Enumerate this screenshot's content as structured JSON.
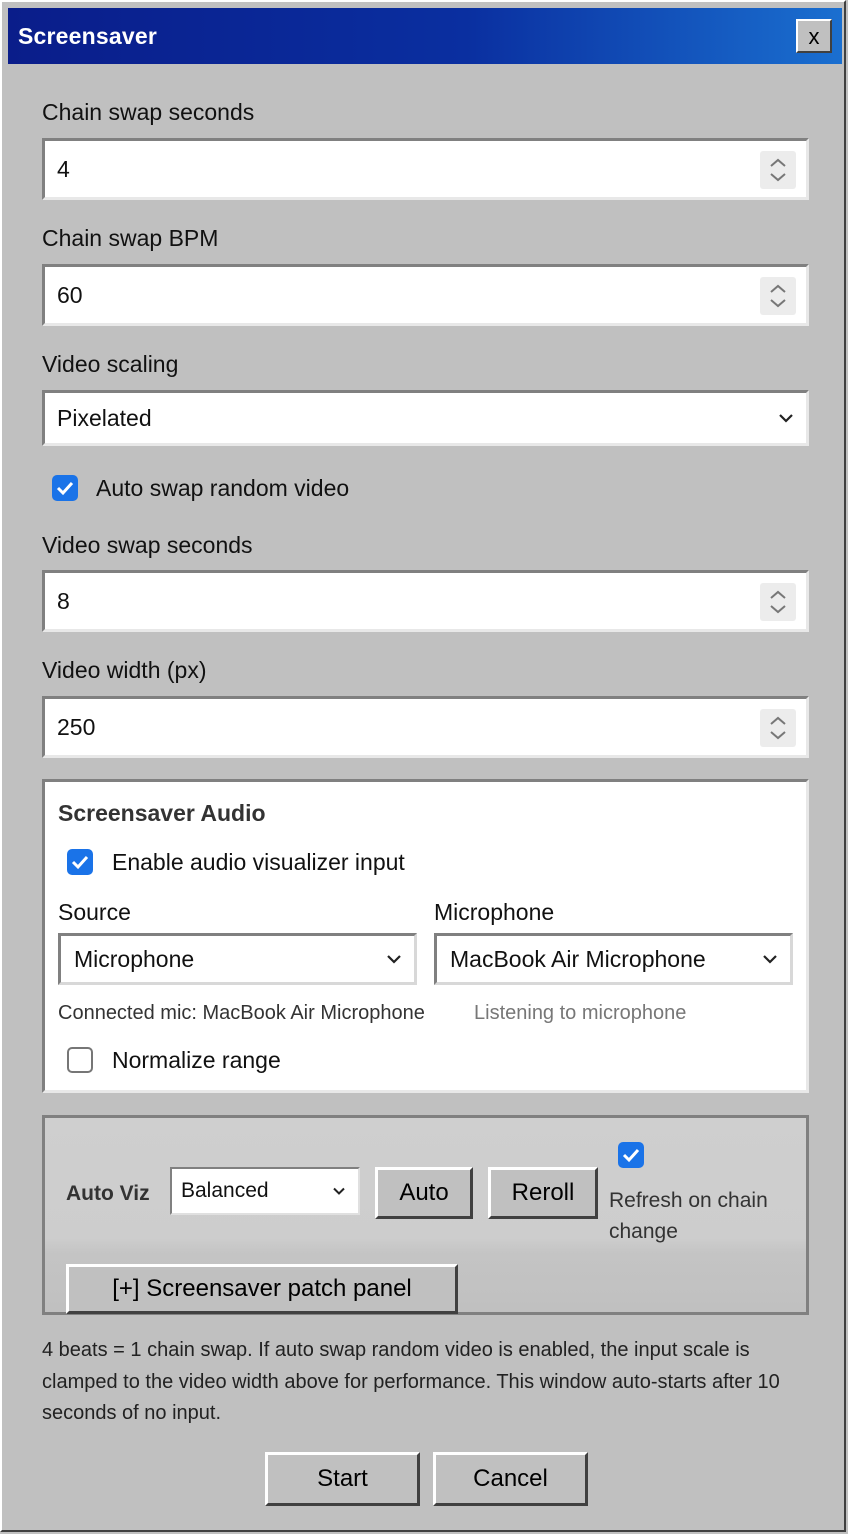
{
  "window": {
    "title": "Screensaver",
    "close_label": "x"
  },
  "fields": {
    "chain_swap_seconds": {
      "label": "Chain swap seconds",
      "value": "4"
    },
    "chain_swap_bpm": {
      "label": "Chain swap BPM",
      "value": "60"
    },
    "video_scaling": {
      "label": "Video scaling",
      "value": "Pixelated"
    },
    "auto_swap": {
      "label": "Auto swap random video",
      "checked": true
    },
    "video_swap_seconds": {
      "label": "Video swap seconds",
      "value": "8"
    },
    "video_width": {
      "label": "Video width (px)",
      "value": "250"
    }
  },
  "audio": {
    "heading": "Screensaver Audio",
    "enable": {
      "label": "Enable audio visualizer input",
      "checked": true
    },
    "source": {
      "label": "Source",
      "value": "Microphone"
    },
    "microphone": {
      "label": "Microphone",
      "value": "MacBook Air Microphone"
    },
    "connected_text": "Connected mic: MacBook Air Microphone",
    "listening_text": "Listening to microphone",
    "normalize": {
      "label": "Normalize range",
      "checked": false
    }
  },
  "autoviz": {
    "label": "Auto Viz",
    "mode": "Balanced",
    "auto_button": "Auto",
    "reroll_button": "Reroll",
    "refresh": {
      "label": "Refresh on chain change",
      "checked": true
    },
    "patch_button": "[+] Screensaver patch panel"
  },
  "note": "4 beats = 1 chain swap. If auto swap random video is enabled, the input scale is clamped to the video width above for performance. This window auto-starts after 10 seconds of no input.",
  "footer": {
    "start_button": "Start",
    "cancel_button": "Cancel"
  },
  "colors": {
    "title_gradient_start": "#0a1d8a",
    "title_gradient_end": "#1a6fd0",
    "checkbox_accent": "#1a73e8",
    "window_bg": "#c0c0c0"
  }
}
